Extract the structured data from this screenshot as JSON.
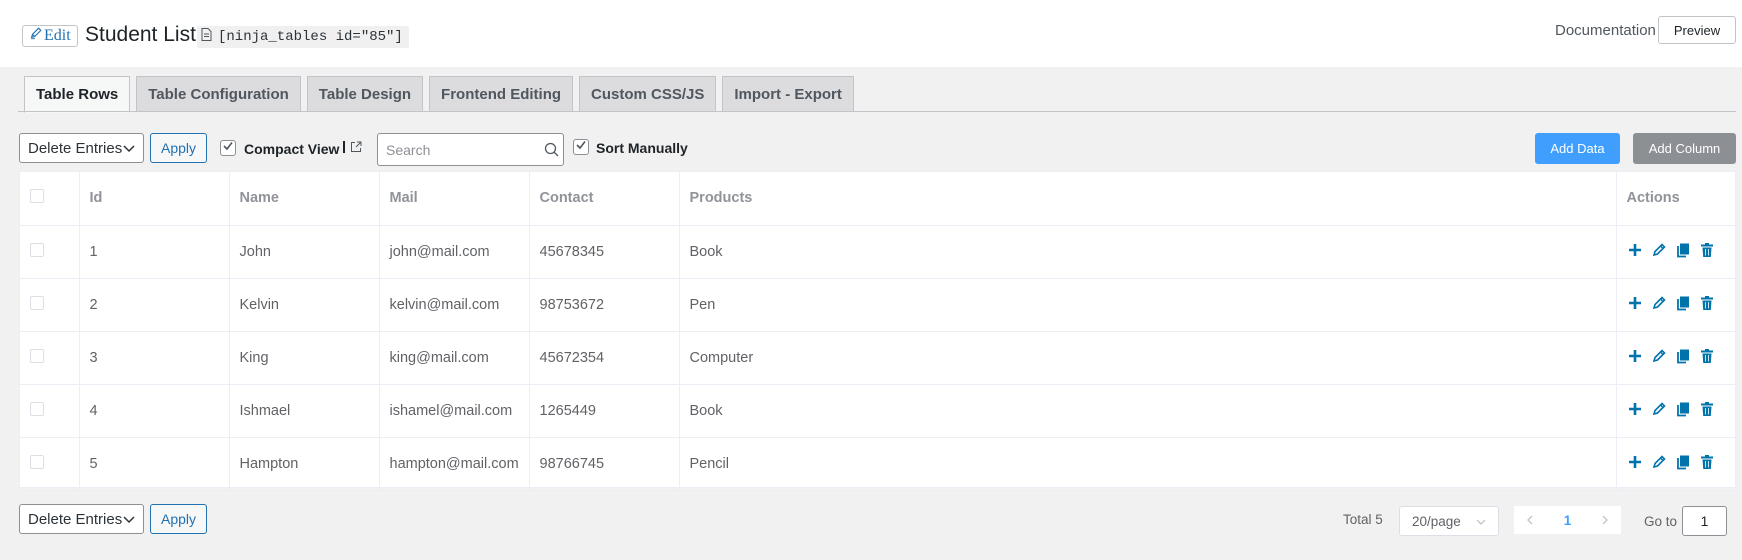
{
  "header": {
    "edit_label": "Edit",
    "title": "Student List",
    "shortcode": "[ninja_tables id=\"85\"]",
    "documentation": "Documentation",
    "preview": "Preview"
  },
  "tabs": [
    {
      "label": "Table Rows",
      "active": true
    },
    {
      "label": "Table Configuration"
    },
    {
      "label": "Table Design"
    },
    {
      "label": "Frontend Editing"
    },
    {
      "label": "Custom CSS/JS"
    },
    {
      "label": "Import - Export"
    }
  ],
  "toolbar": {
    "bulk_action": "Delete Entries",
    "apply": "Apply",
    "compact_view": "Compact View",
    "compact_view_checked": true,
    "separator": "|",
    "search_placeholder": "Search",
    "sort_manually": "Sort Manually",
    "sort_manually_checked": true,
    "add_data": "Add Data",
    "add_column": "Add Column"
  },
  "table": {
    "columns": [
      "Id",
      "Name",
      "Mail",
      "Contact",
      "Products",
      "Actions"
    ],
    "rows": [
      {
        "id": "1",
        "name": "John",
        "mail": "john@mail.com",
        "contact": "45678345",
        "product": "Book"
      },
      {
        "id": "2",
        "name": "Kelvin",
        "mail": "kelvin@mail.com",
        "contact": "98753672",
        "product": "Pen"
      },
      {
        "id": "3",
        "name": "King",
        "mail": "king@mail.com",
        "contact": "45672354",
        "product": "Computer"
      },
      {
        "id": "4",
        "name": "Ishmael",
        "mail": "ishamel@mail.com",
        "contact": "1265449",
        "product": "Book"
      },
      {
        "id": "5",
        "name": "Hampton",
        "mail": "hampton@mail.com",
        "contact": "98766745",
        "product": "Pencil"
      }
    ],
    "row_actions": [
      "add-icon",
      "edit-icon",
      "duplicate-icon",
      "delete-icon"
    ]
  },
  "footer": {
    "bulk_action": "Delete Entries",
    "apply": "Apply",
    "total": "Total 5",
    "page_size": "20/page",
    "current_page": "1",
    "goto_label": "Go to",
    "goto_value": "1"
  },
  "colors": {
    "primary_blue": "#409eff",
    "wp_blue": "#2271b1",
    "action_icon": "#0073aa",
    "add_column_bg": "#8c8f94"
  }
}
